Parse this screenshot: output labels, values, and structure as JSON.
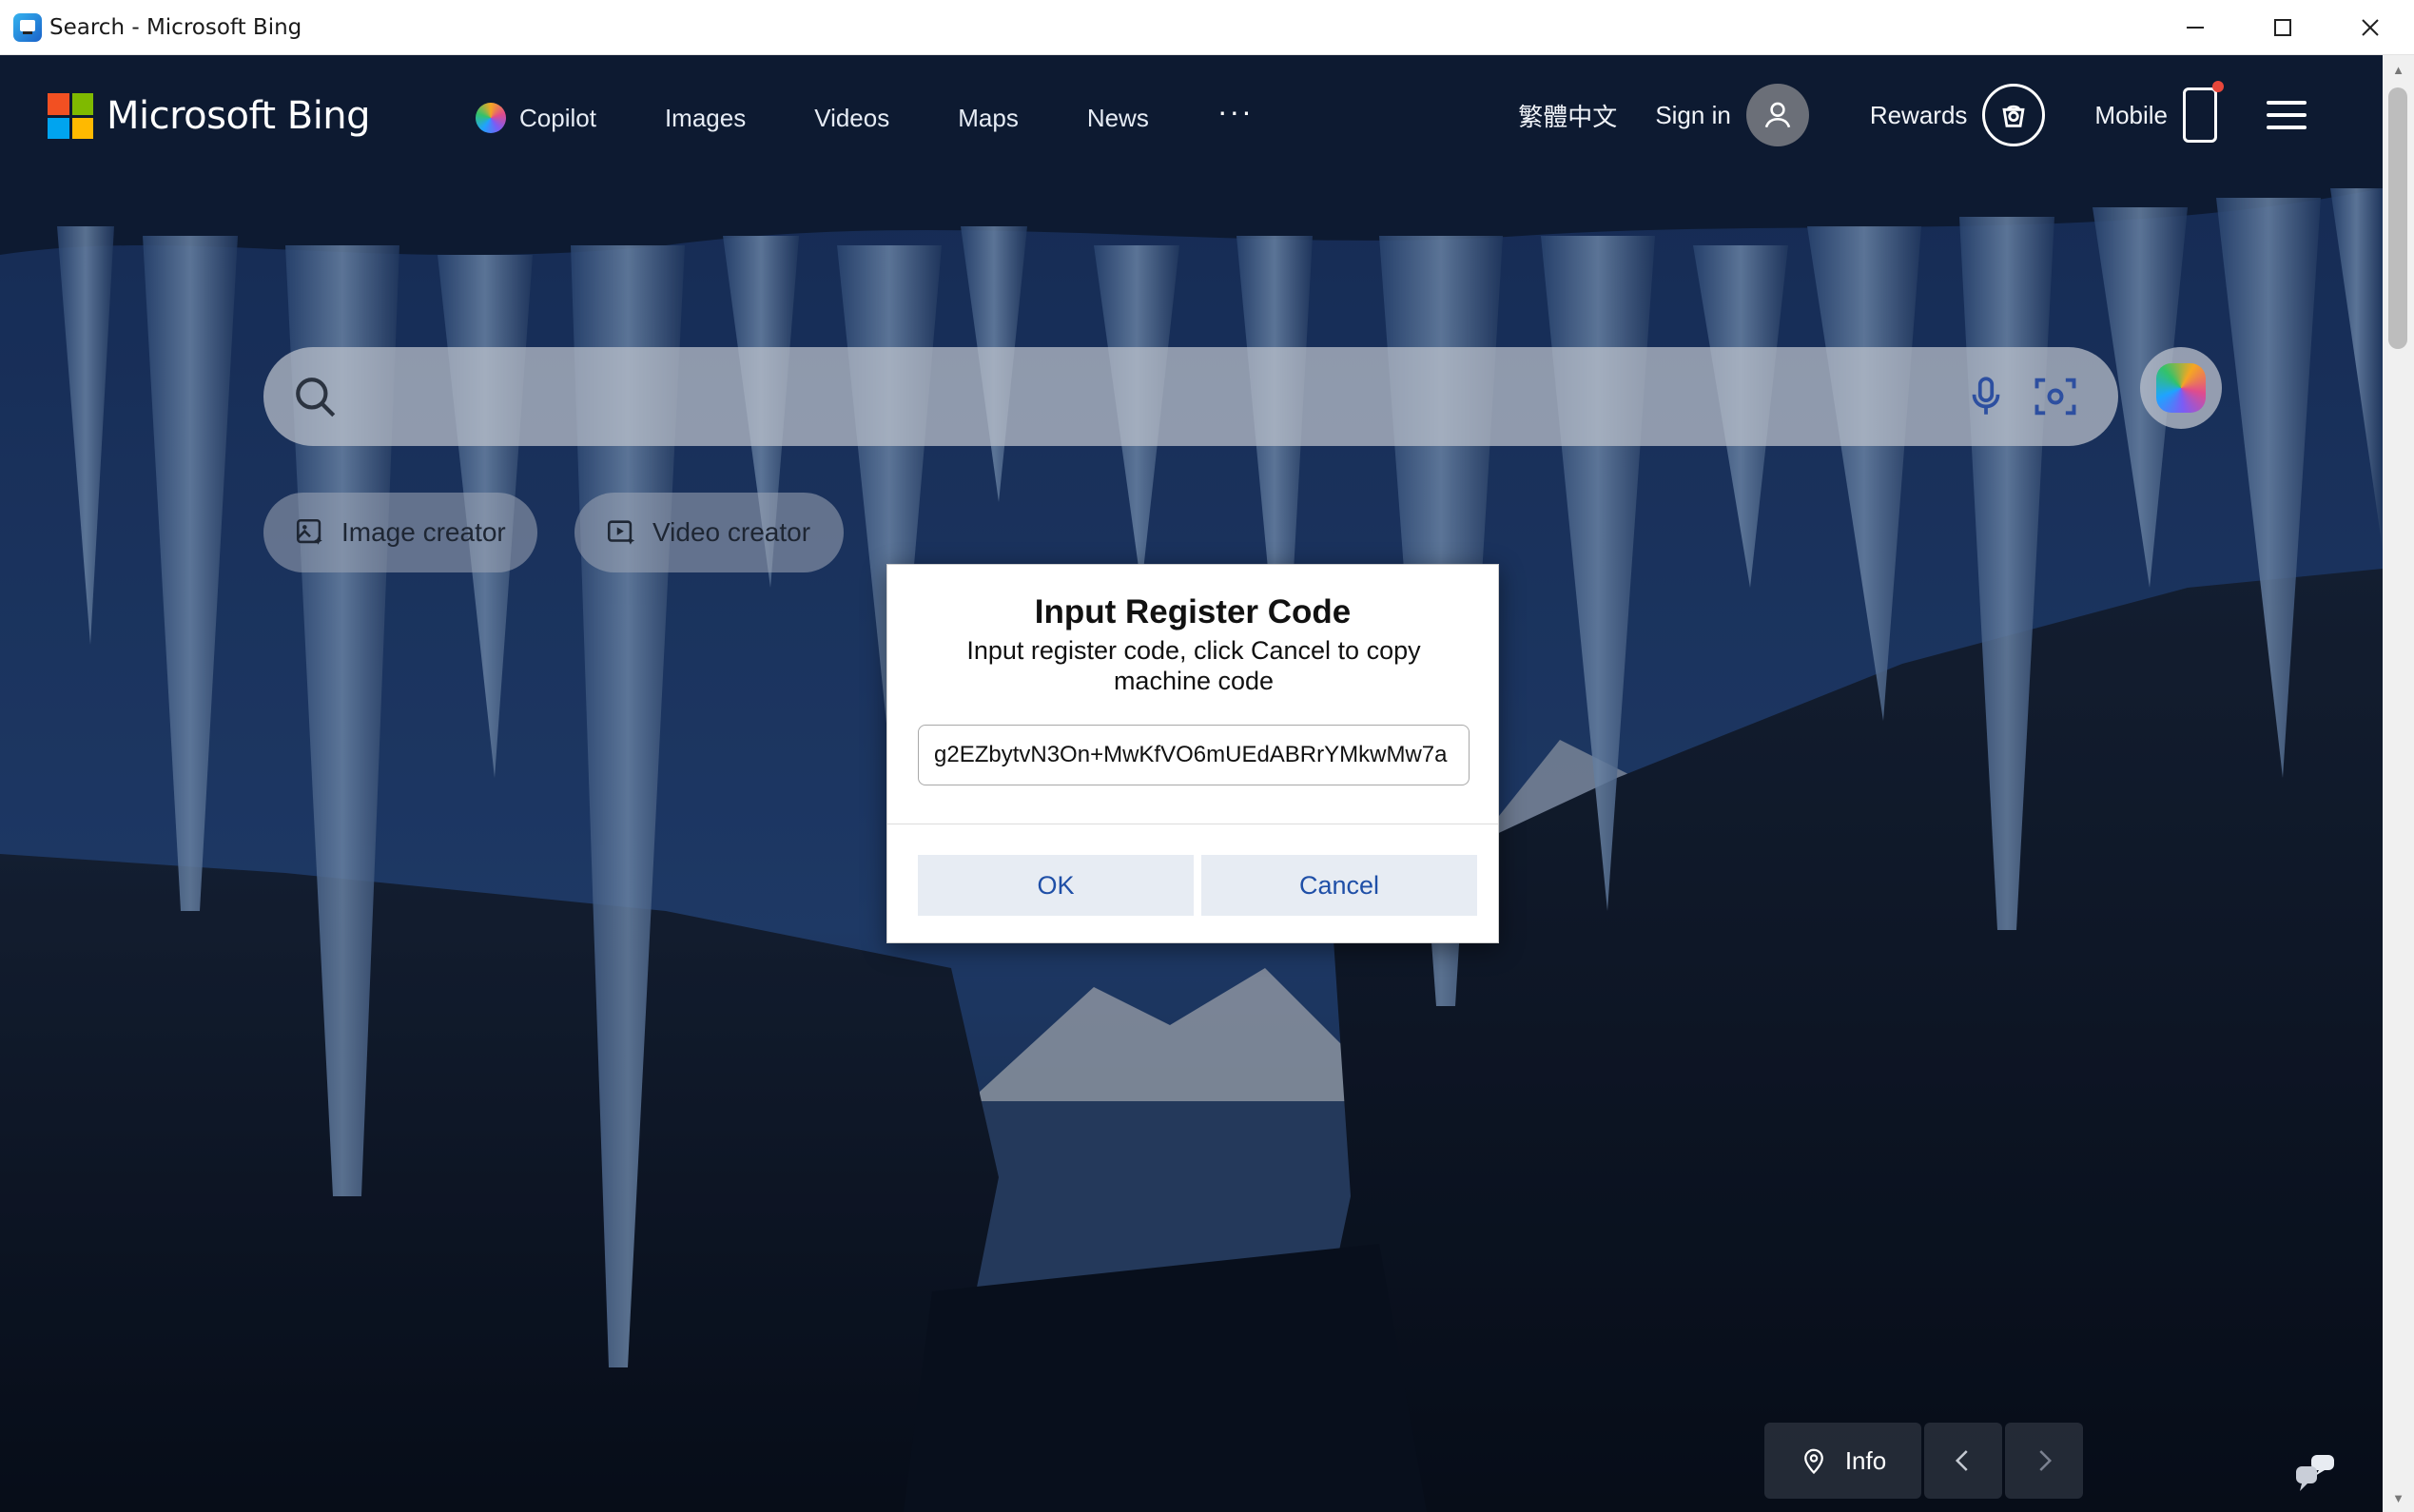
{
  "window": {
    "title": "Search - Microsoft Bing",
    "controls": [
      "minimize-icon",
      "maximize-icon",
      "close-icon"
    ]
  },
  "header": {
    "logo_text": "Microsoft Bing",
    "nav": [
      {
        "label": "Copilot",
        "icon": "copilot-icon"
      },
      {
        "label": "Images"
      },
      {
        "label": "Videos"
      },
      {
        "label": "Maps"
      },
      {
        "label": "News"
      }
    ],
    "more": "···",
    "language": "繁體中文",
    "sign_in": "Sign in",
    "rewards": "Rewards",
    "mobile": "Mobile"
  },
  "search": {
    "placeholder": "",
    "value": ""
  },
  "creators": {
    "image_creator": "Image creator",
    "video_creator": "Video creator"
  },
  "bottom": {
    "info_label": "Info"
  },
  "dialog": {
    "title": "Input Register Code",
    "message": "Input register code, click Cancel to copy machine code",
    "input_value": "g2EZbytvN3On+MwKfVO6mUEdABRrYMkwMw7a",
    "ok_label": "OK",
    "cancel_label": "Cancel"
  },
  "colors": {
    "accent": "#1f4fa7",
    "button_bg": "#e7ecf3",
    "ms_red": "#f25022",
    "ms_green": "#7fba00",
    "ms_blue": "#00a4ef",
    "ms_yellow": "#ffb900"
  }
}
